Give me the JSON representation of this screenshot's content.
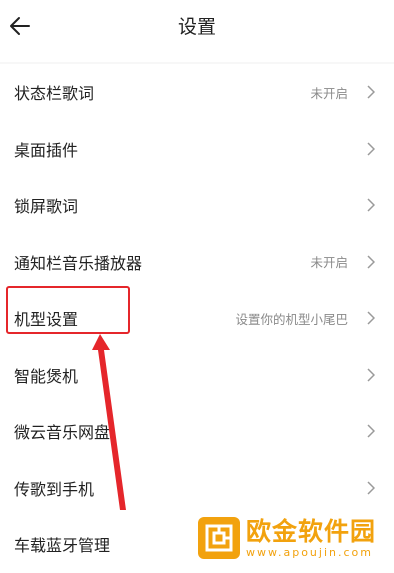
{
  "header": {
    "title": "设置",
    "back_icon": "arrow-left-icon"
  },
  "settings": {
    "items": [
      {
        "label": "状态栏歌词",
        "value": "未开启"
      },
      {
        "label": "桌面插件",
        "value": ""
      },
      {
        "label": "锁屏歌词",
        "value": ""
      },
      {
        "label": "通知栏音乐播放器",
        "value": "未开启"
      },
      {
        "label": "机型设置",
        "value": "设置你的机型小尾巴"
      },
      {
        "label": "智能煲机",
        "value": ""
      },
      {
        "label": "微云音乐网盘",
        "value": ""
      },
      {
        "label": "传歌到手机",
        "value": ""
      },
      {
        "label": "车载蓝牙管理",
        "value": ""
      }
    ]
  },
  "annotation": {
    "color": "#e5262b"
  },
  "watermark": {
    "title": "欧金软件园",
    "url": "www.apoujin.com",
    "color": "#f2a20e"
  }
}
